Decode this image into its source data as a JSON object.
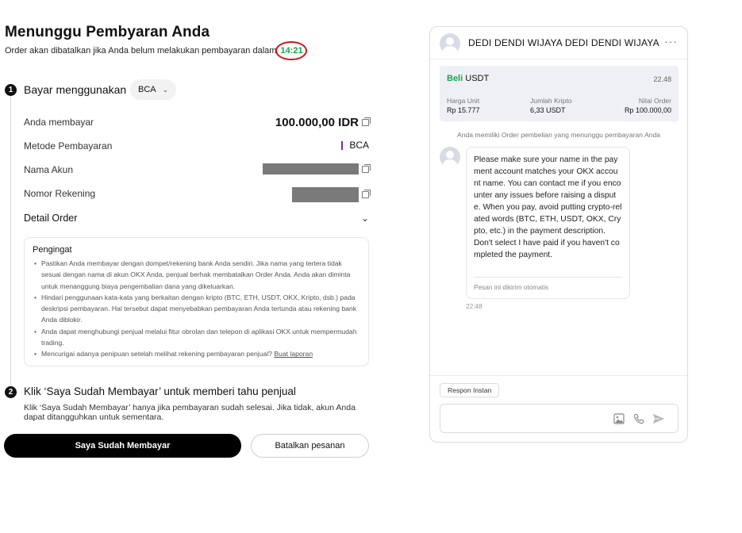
{
  "header": {
    "title": "Menunggu Pembyaran Anda",
    "subtitle": "Order akan dibatalkan jika Anda belum melakukan pembayaran dalam",
    "countdown": "14:21"
  },
  "step1": {
    "number": "1",
    "title": "Bayar menggunakan",
    "bank_selected": "BCA",
    "rows": {
      "amount_label": "Anda membayar",
      "amount_value": "100.000,00 IDR",
      "method_label": "Metode Pembayaran",
      "method_value": "BCA",
      "account_name_label": "Nama Akun",
      "account_number_label": "Nomor Rekening"
    },
    "detail_order_label": "Detail Order"
  },
  "notice": {
    "title": "Pengingat",
    "items": [
      "Pastikan Anda membayar dengan dompet/rekening bank Anda sendiri. Jika nama yang tertera tidak sesuai dengan nama di akun OKX Anda, penjual berhak membatalkan Order Anda. Anda akan diminta untuk menanggung biaya pengembalian dana yang dikeluarkan.",
      "Hindari penggunaan kata-kata yang berkaitan dengan kripto (BTC, ETH, USDT, OKX, Kripto, dsb.) pada deskripsi pembayaran. Hal tersebut dapat menyebabkan pembayaran Anda tertunda atau rekening bank Anda diblokir.",
      "Anda dapat menghubungi penjual melalui fitur obrolan dan telepon di aplikasi OKX untuk mempermudah trading.",
      "Mencurigai adanya penipuan setelah melihat rekening pembayaran penjual?"
    ],
    "report_link": "Buat laporan"
  },
  "step2": {
    "number": "2",
    "title": "Klik ‘Saya Sudah Membayar’ untuk memberi tahu penjual",
    "description": "Klik ‘Saya Sudah Membayar’ hanya jika pembayaran sudah selesai. Jika tidak, akun Anda dapat ditangguhkan untuk sementara."
  },
  "actions": {
    "paid_button": "Saya Sudah Membayar",
    "cancel_button": "Batalkan pesanan"
  },
  "chat": {
    "seller_name": "DEDI DENDI WIJAYA DEDI DENDI WIJAYA",
    "more_icon": "more-icon",
    "order": {
      "type": "Beli",
      "asset": "USDT",
      "time": "22.48",
      "unit_price_label": "Harga Unit",
      "unit_price_value": "Rp 15.777",
      "crypto_amount_label": "Jumlah Kripto",
      "crypto_amount_value": "6,33 USDT",
      "order_value_label": "Nilai Order",
      "order_value_value": "Rp 100.000,00"
    },
    "system_message": "Anda memiliki Order pembelian yang menunggu pembayaran Anda",
    "message": {
      "text": "Please make sure your name in the payment account matches your OKX account name. You can contact me if you encounter any issues before raising a dispute. When you pay, avoid putting crypto-related words (BTC, ETH, USDT, OKX, Crypto, etc.) in the payment description.\nDon't select I have paid if you haven't completed the payment.",
      "auto_note": "Pesan ini dikirim otomatis",
      "time": "22:48"
    },
    "quick_reply": "Respon Instan",
    "composer_placeholder": ""
  },
  "colors": {
    "accent_green": "#1aa34a",
    "timer_circle": "#d0141b",
    "primary_button": "#000000",
    "bca_bar": "#7b2b8c"
  }
}
